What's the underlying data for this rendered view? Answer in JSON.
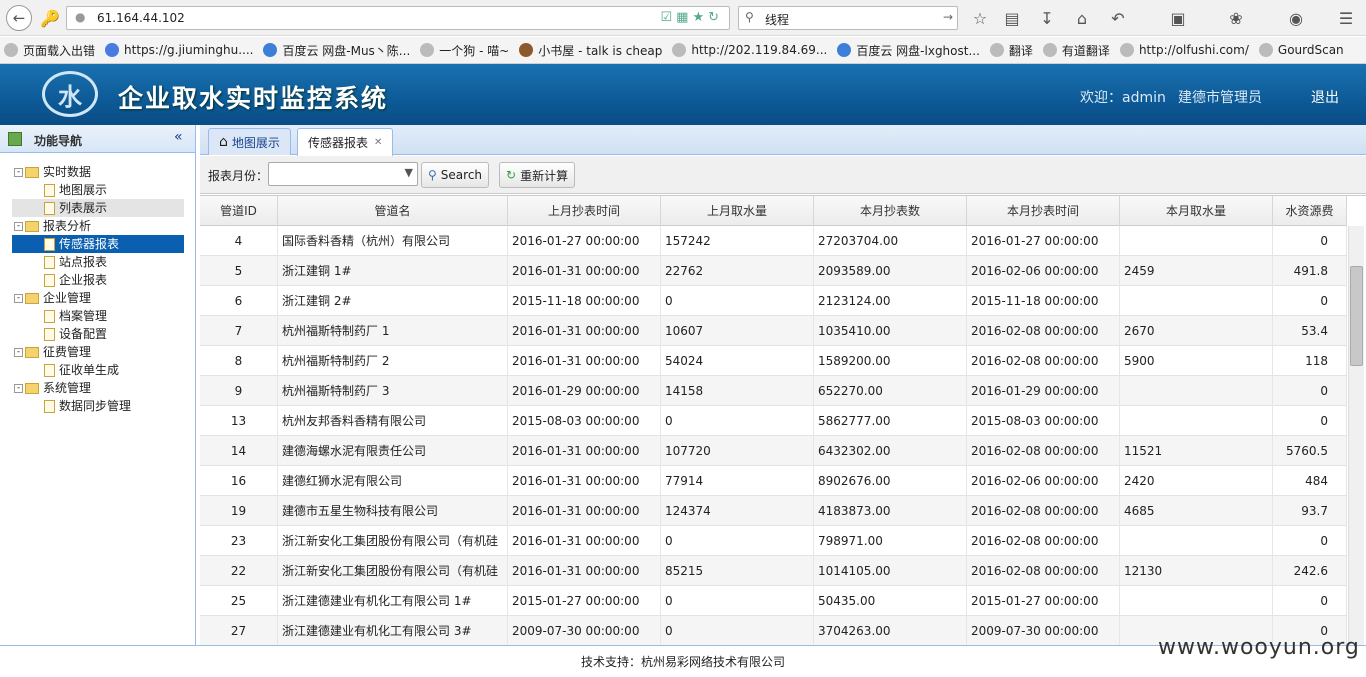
{
  "browser": {
    "url": "61.164.44.102",
    "search_text": "线程"
  },
  "bookmarks": [
    "页面载入出错",
    "https://g.jiuminghu....",
    "百度云 网盘-Mus丶陈...",
    "一个狗 - 喵~",
    "小书屋 - talk is cheap",
    "http://202.119.84.69...",
    "百度云 网盘-lxghost...",
    "翻译",
    "有道翻译",
    "http://olfushi.com/",
    "GourdScan"
  ],
  "header": {
    "title": "企业取水实时监控系统",
    "welcome": "欢迎：admin",
    "city_admin": "建德市管理员",
    "logout": "退出"
  },
  "sidebar": {
    "title": "功能导航",
    "groups": [
      {
        "label": "实时数据",
        "items": [
          "地图展示",
          "列表展示"
        ]
      },
      {
        "label": "报表分析",
        "items": [
          "传感器报表",
          "站点报表",
          "企业报表"
        ]
      },
      {
        "label": "企业管理",
        "items": [
          "档案管理",
          "设备配置"
        ]
      },
      {
        "label": "征费管理",
        "items": [
          "征收单生成"
        ]
      },
      {
        "label": "系统管理",
        "items": [
          "数据同步管理"
        ]
      }
    ]
  },
  "tabs": {
    "map": "地图展示",
    "sensor": "传感器报表"
  },
  "toolbar": {
    "month_label": "报表月份：",
    "month_value": "",
    "search_label": "Search",
    "recalc_label": "重新计算"
  },
  "table": {
    "columns": [
      "管道ID",
      "管道名",
      "上月抄表时间",
      "上月取水量",
      "本月抄表数",
      "本月抄表时间",
      "本月取水量",
      "水资源费"
    ],
    "rows": [
      [
        "4",
        "国际香料香精（杭州）有限公司",
        "2016-01-27 00:00:00",
        "157242",
        "27203704.00",
        "2016-01-27 00:00:00",
        "",
        "0"
      ],
      [
        "5",
        "浙江建铜 1#",
        "2016-01-31 00:00:00",
        "22762",
        "2093589.00",
        "2016-02-06 00:00:00",
        "2459",
        "491.8"
      ],
      [
        "6",
        "浙江建铜 2#",
        "2015-11-18 00:00:00",
        "0",
        "2123124.00",
        "2015-11-18 00:00:00",
        "",
        "0"
      ],
      [
        "7",
        "杭州福斯特制药厂 1",
        "2016-01-31 00:00:00",
        "10607",
        "1035410.00",
        "2016-02-08 00:00:00",
        "2670",
        "53.4"
      ],
      [
        "8",
        "杭州福斯特制药厂 2",
        "2016-01-31 00:00:00",
        "54024",
        "1589200.00",
        "2016-02-08 00:00:00",
        "5900",
        "118"
      ],
      [
        "9",
        "杭州福斯特制药厂 3",
        "2016-01-29 00:00:00",
        "14158",
        "652270.00",
        "2016-01-29 00:00:00",
        "",
        "0"
      ],
      [
        "13",
        "杭州友邦香料香精有限公司",
        "2015-08-03 00:00:00",
        "0",
        "5862777.00",
        "2015-08-03 00:00:00",
        "",
        "0"
      ],
      [
        "14",
        "建德海螺水泥有限责任公司",
        "2016-01-31 00:00:00",
        "107720",
        "6432302.00",
        "2016-02-08 00:00:00",
        "11521",
        "5760.5"
      ],
      [
        "16",
        "建德红狮水泥有限公司",
        "2016-01-31 00:00:00",
        "77914",
        "8902676.00",
        "2016-02-06 00:00:00",
        "2420",
        "484"
      ],
      [
        "19",
        "建德市五星生物科技有限公司",
        "2016-01-31 00:00:00",
        "124374",
        "4183873.00",
        "2016-02-08 00:00:00",
        "4685",
        "93.7"
      ],
      [
        "23",
        "浙江新安化工集团股份有限公司（有机硅",
        "2016-01-31 00:00:00",
        "0",
        "798971.00",
        "2016-02-08 00:00:00",
        "",
        "0"
      ],
      [
        "22",
        "浙江新安化工集团股份有限公司（有机硅",
        "2016-01-31 00:00:00",
        "85215",
        "1014105.00",
        "2016-02-08 00:00:00",
        "12130",
        "242.6"
      ],
      [
        "25",
        "浙江建德建业有机化工有限公司 1#",
        "2015-01-27 00:00:00",
        "0",
        "50435.00",
        "2015-01-27 00:00:00",
        "",
        "0"
      ],
      [
        "27",
        "浙江建德建业有机化工有限公司 3#",
        "2009-07-30 00:00:00",
        "0",
        "3704263.00",
        "2009-07-30 00:00:00",
        "",
        "0"
      ]
    ]
  },
  "footer": {
    "text": "技术支持：杭州易彩网络技术有限公司"
  },
  "watermark": "www.wooyun.org"
}
